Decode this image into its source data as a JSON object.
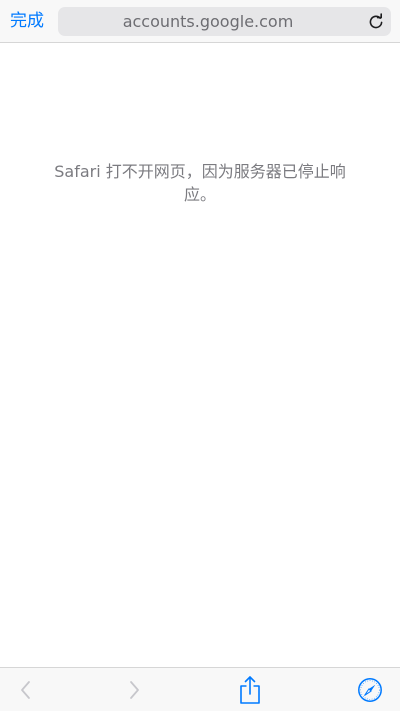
{
  "navbar": {
    "done_label": "完成",
    "url": "accounts.google.com"
  },
  "page": {
    "error_message": "Safari 打不开网页，因为服务器已停止响应。"
  },
  "icons": {
    "reload": "reload-icon",
    "back": "chevron-left-icon",
    "forward": "chevron-right-icon",
    "share": "share-icon",
    "safari": "compass-icon"
  },
  "colors": {
    "accent": "#007aff",
    "disabled": "#c7c7cc",
    "bar_background": "#f8f8f8"
  }
}
